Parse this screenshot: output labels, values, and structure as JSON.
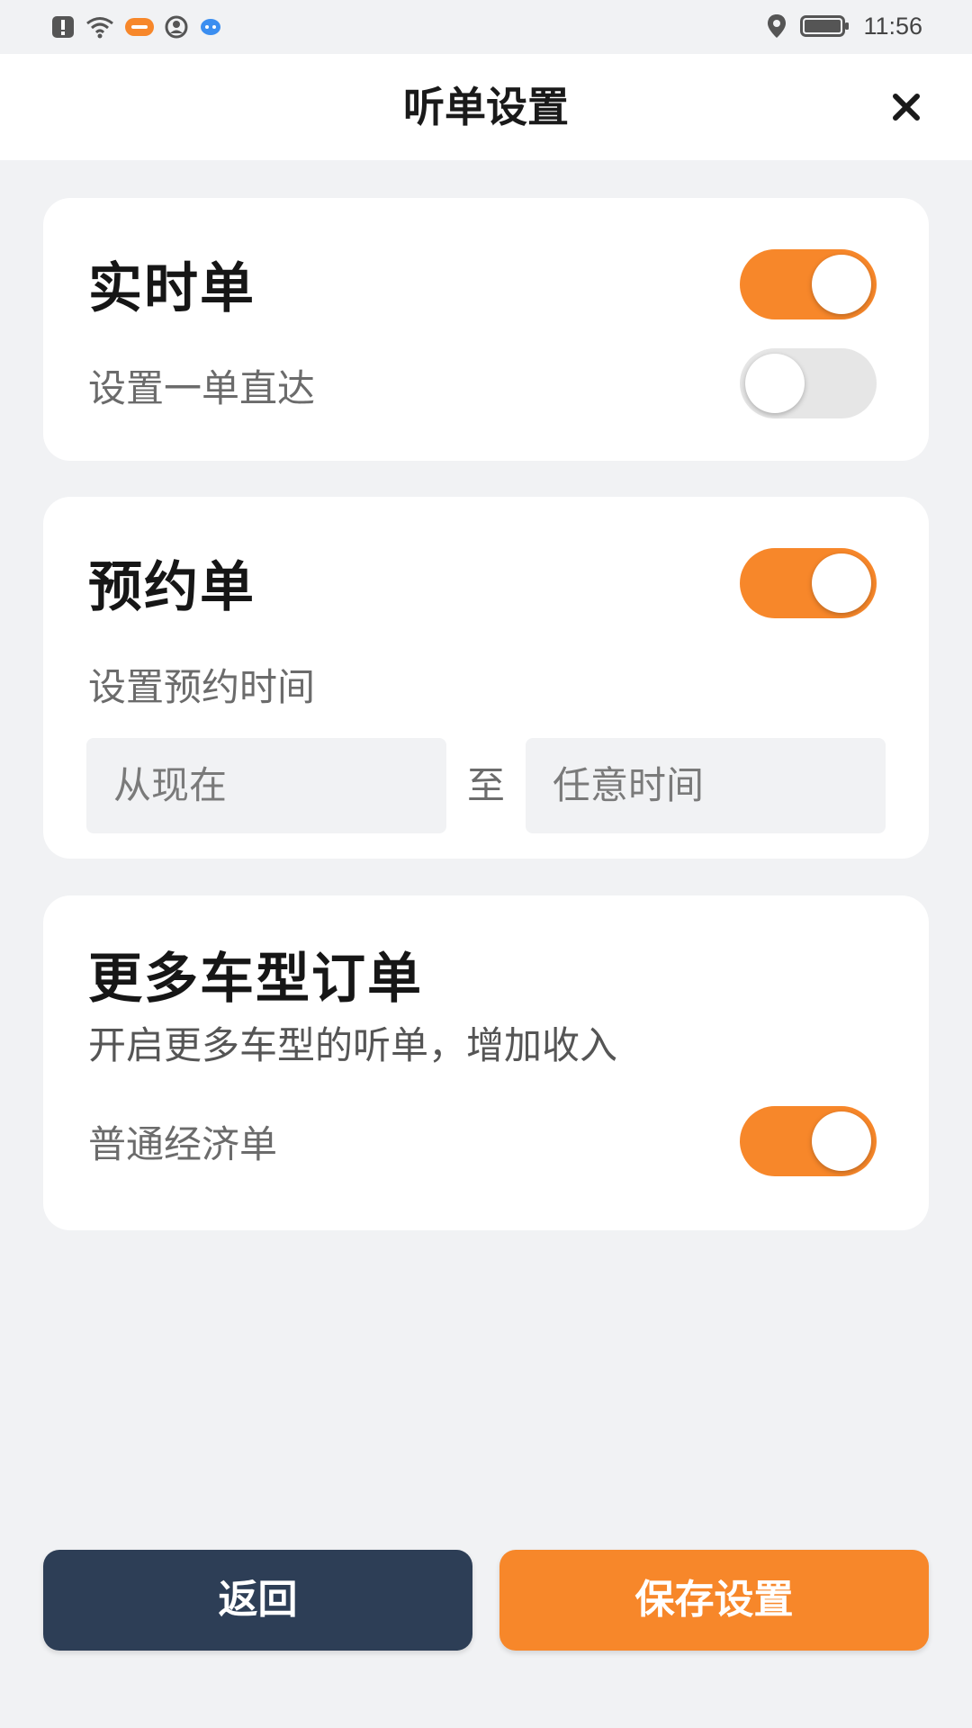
{
  "status_bar": {
    "time": "11:56",
    "icons_left": [
      "alert-icon",
      "wifi-icon",
      "app-badge-icon",
      "face-icon",
      "bubble-icon"
    ],
    "icons_right": [
      "location-icon",
      "battery-icon"
    ]
  },
  "header": {
    "title": "听单设置",
    "close_label": "×"
  },
  "realtime": {
    "title": "实时单",
    "enabled": true,
    "direct_label": "设置一单直达",
    "direct_enabled": false
  },
  "reservation": {
    "title": "预约单",
    "enabled": true,
    "time_label": "设置预约时间",
    "from_value": "从现在",
    "separator": "至",
    "to_value": "任意时间"
  },
  "more_vehicles": {
    "title": "更多车型订单",
    "description": "开启更多车型的听单，增加收入",
    "economy_label": "普通经济单",
    "economy_enabled": true
  },
  "footer": {
    "back_label": "返回",
    "save_label": "保存设置"
  },
  "colors": {
    "accent": "#f7872a",
    "dark_button": "#2d3e56",
    "background": "#f1f2f4"
  }
}
